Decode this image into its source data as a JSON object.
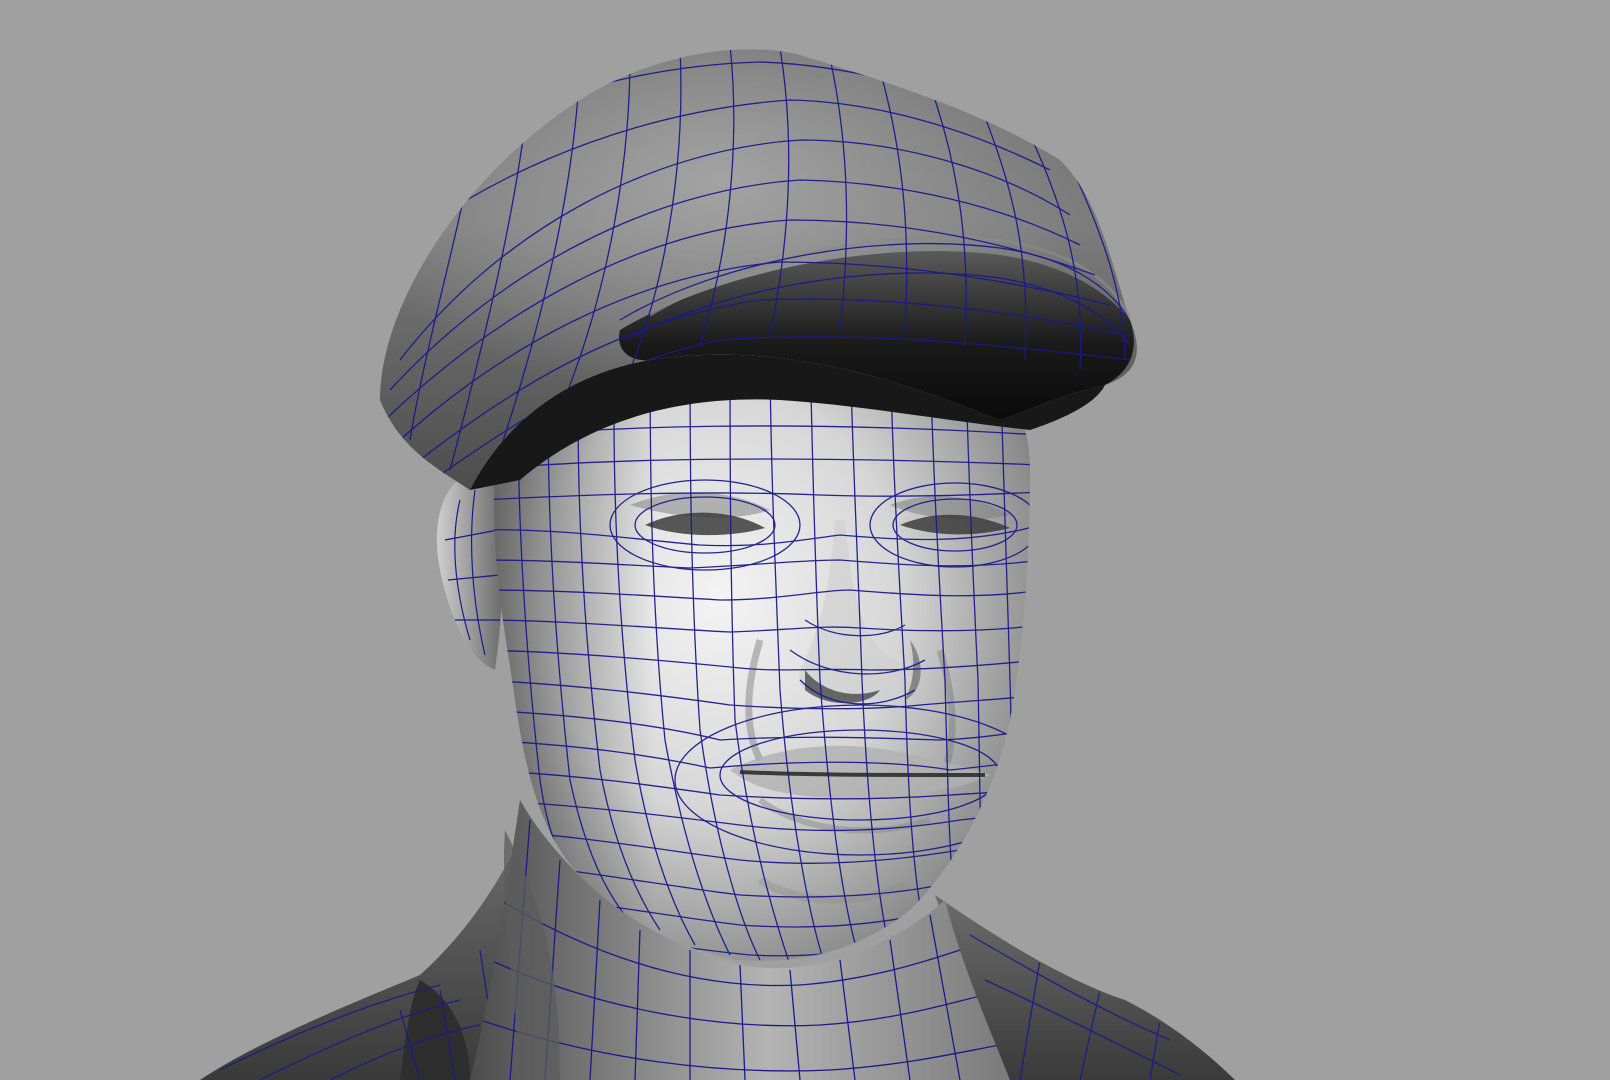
{
  "viewport": {
    "background_color": "#a0a0a0",
    "wire_color": "#1a1a8c",
    "shade_light": "#eeeeee",
    "shade_mid": "#9a9a9a",
    "shade_dark": "#2a2a2a"
  },
  "scene": {
    "subject": "wireframe-shaded-head-model",
    "parts": [
      "cap",
      "cap-brim",
      "head",
      "ear",
      "neck",
      "shirt-collar",
      "shoulders"
    ]
  }
}
